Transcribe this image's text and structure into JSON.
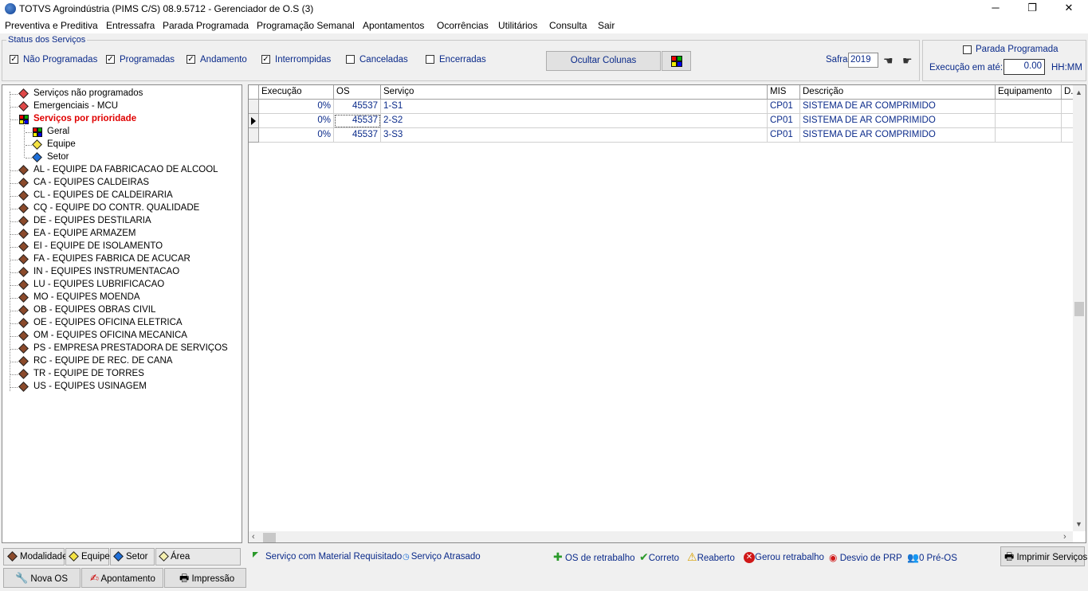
{
  "window": {
    "title": "TOTVS Agroindústria (PIMS C/S) 08.9.5712 - Gerenciador de O.S (3)",
    "minimize": "─",
    "restore": "❐",
    "close": "✕"
  },
  "menu": [
    "Preventiva e Preditiva",
    "Entressafra",
    "Parada Programada",
    "Programação Semanal",
    "Apontamentos",
    "Ocorrências",
    "Utilitários",
    "Consulta",
    "Sair"
  ],
  "status": {
    "label": "Status dos Serviços",
    "items": [
      {
        "label": "Não Programadas",
        "checked": true
      },
      {
        "label": "Programadas",
        "checked": true
      },
      {
        "label": "Andamento",
        "checked": true
      },
      {
        "label": "Interrompidas",
        "checked": true
      },
      {
        "label": "Canceladas",
        "checked": false
      },
      {
        "label": "Encerradas",
        "checked": false
      }
    ],
    "hide_columns_button": "Ocultar Colunas",
    "safra_label": "Safra",
    "safra_value": "2019"
  },
  "parada": {
    "label": "Parada Programada",
    "checked": false,
    "exec_label": "Execução em até:",
    "exec_value": "0.00",
    "unit": "HH:MM"
  },
  "tree": {
    "top_items": [
      {
        "label": "Serviços não programados",
        "color": "#e04848"
      },
      {
        "label": "Emergenciais - MCU",
        "color": "#e04848"
      }
    ],
    "priority": {
      "label": "Serviços por prioridade",
      "color": "#e00000"
    },
    "priority_children": [
      {
        "label": "Geral",
        "icon": "grid-icon"
      },
      {
        "label": "Equipe",
        "color": "#f5e342"
      },
      {
        "label": "Setor",
        "color": "#1e6fd9"
      }
    ],
    "teams": [
      "AL - EQUIPE DA FABRICACAO DE ALCOOL",
      "CA - EQUIPES CALDEIRAS",
      "CL - EQUIPES DE CALDEIRARIA",
      "CQ - EQUIPE DO CONTR. QUALIDADE",
      "DE - EQUIPES DESTILARIA",
      "EA - EQUIPE ARMAZEM",
      "EI - EQUIPE DE ISOLAMENTO",
      "FA - EQUIPES FABRICA DE ACUCAR",
      "IN - EQUIPES INSTRUMENTACAO",
      "LU - EQUIPES LUBRIFICACAO",
      "MO - EQUIPES MOENDA",
      "OB - EQUIPES OBRAS CIVIL",
      "OE - EQUIPES OFICINA ELETRICA",
      "OM - EQUIPES OFICINA MECANICA",
      "PS - EMPRESA PRESTADORA DE SERVIÇOS",
      "RC - EQUIPE DE REC. DE CANA",
      "TR - EQUIPE DE TORRES",
      "US - EQUIPES USINAGEM"
    ],
    "team_color": "#8b4a2b"
  },
  "grid": {
    "columns": [
      "Execução",
      "OS",
      "Serviço",
      "MIS",
      "Descrição",
      "Equipamento",
      "D..."
    ],
    "rows": [
      [
        "0%",
        "45537",
        "1-S1",
        "CP01",
        "SISTEMA DE AR COMPRIMIDO",
        "",
        ""
      ],
      [
        "0%",
        "45537",
        "2-S2",
        "CP01",
        "SISTEMA DE AR COMPRIMIDO",
        "",
        ""
      ],
      [
        "0%",
        "45537",
        "3-S3",
        "CP01",
        "SISTEMA DE AR COMPRIMIDO",
        "",
        ""
      ]
    ],
    "current_row": 1
  },
  "tabs": [
    "Modalidade",
    "Equipe",
    "Setor",
    "Área"
  ],
  "legend": {
    "material": "Serviço com Material Requisitado",
    "atrasado": "Serviço Atrasado",
    "retrabalho": "OS de retrabalho",
    "correto": "Correto",
    "reaberto": "Reaberto",
    "gerou": "Gerou retrabalho",
    "desvio": "Desvio de PRP",
    "preos": "0 Pré-OS"
  },
  "actions": {
    "nova_os": "Nova OS",
    "apontamento": "Apontamento",
    "impressao": "Impressão",
    "imprimir": "Imprimir Serviços"
  },
  "colors": {
    "link_blue": "#0a2a8a",
    "priority_red": "#e00000"
  }
}
